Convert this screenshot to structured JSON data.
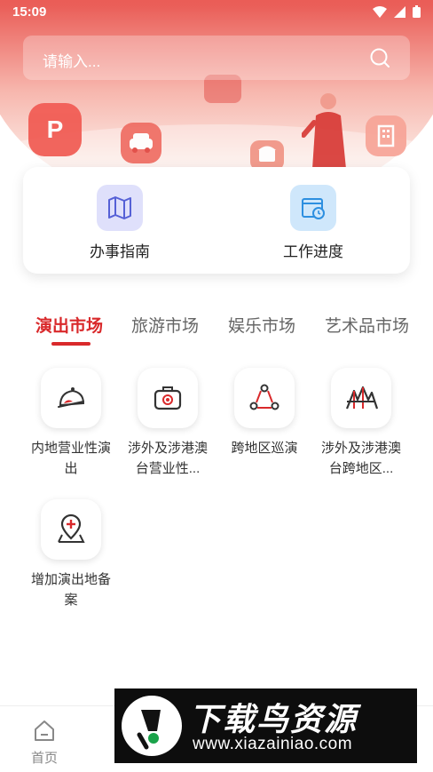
{
  "status_bar": {
    "time": "15:09"
  },
  "search": {
    "placeholder": "请输入..."
  },
  "hero": {
    "parking_badge": "P"
  },
  "quick_actions": [
    {
      "label": "办事指南",
      "icon": "map-guide-icon"
    },
    {
      "label": "工作进度",
      "icon": "calendar-clock-icon"
    }
  ],
  "tabs": [
    {
      "label": "演出市场",
      "active": true
    },
    {
      "label": "旅游市场",
      "active": false
    },
    {
      "label": "娱乐市场",
      "active": false
    },
    {
      "label": "艺术品市场",
      "active": false
    }
  ],
  "services": [
    {
      "label": "内地营业性演出",
      "icon": "stage-performance-icon"
    },
    {
      "label": "涉外及涉港澳台营业性...",
      "icon": "briefcase-icon"
    },
    {
      "label": "跨地区巡演",
      "icon": "tour-nodes-icon"
    },
    {
      "label": "涉外及涉港澳台跨地区...",
      "icon": "mountain-stage-icon"
    },
    {
      "label": "增加演出地备案",
      "icon": "location-add-icon"
    }
  ],
  "bottom_nav": {
    "home_label": "首页"
  },
  "watermark": {
    "title": "下载鸟资源",
    "url": "www.xiazainiao.com"
  },
  "colors": {
    "accent": "#d9292b",
    "hero_red": "#e3423f"
  }
}
